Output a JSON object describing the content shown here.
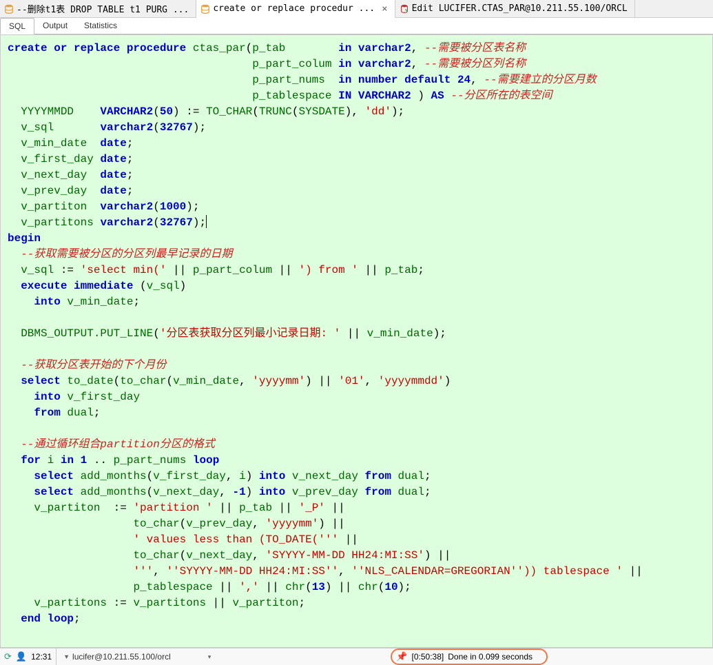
{
  "tabs": [
    {
      "label": "--删除t1表 DROP TABLE t1 PURG ...",
      "active": false,
      "icon": "db"
    },
    {
      "label": "create or replace procedur ...",
      "active": true,
      "icon": "db"
    },
    {
      "label": "Edit LUCIFER.CTAS_PAR@10.211.55.100/ORCL",
      "active": false,
      "icon": "edit"
    }
  ],
  "subtabs": [
    {
      "label": "SQL",
      "active": true
    },
    {
      "label": "Output",
      "active": false
    },
    {
      "label": "Statistics",
      "active": false
    }
  ],
  "code": {
    "l1a": "create or replace procedure",
    "l1b": "ctas_par",
    "l1c": "p_tab",
    "l1d": "in",
    "l1e": "varchar2",
    "l1f": "--需要被分区表名称",
    "l2a": "p_part_colum",
    "l2b": "in",
    "l2c": "varchar2",
    "l2d": "--需要被分区列名称",
    "l3a": "p_part_nums",
    "l3b": "in",
    "l3c": "number",
    "l3d": "default",
    "l3e": "24",
    "l3f": "--需要建立的分区月数",
    "l4a": "p_tablespace",
    "l4b": "IN",
    "l4c": "VARCHAR2",
    "l4d": "AS",
    "l4e": "--分区所在的表空间",
    "l5a": "YYYYMMDD",
    "l5b": "VARCHAR2",
    "l5c": "50",
    "l5d": "TO_CHAR",
    "l5e": "TRUNC",
    "l5f": "SYSDATE",
    "l5g": "'dd'",
    "l6a": "v_sql",
    "l6b": "varchar2",
    "l6c": "32767",
    "l7a": "v_min_date",
    "l7b": "date",
    "l8a": "v_first_day",
    "l8b": "date",
    "l9a": "v_next_day",
    "l9b": "date",
    "l10a": "v_prev_day",
    "l10b": "date",
    "l11a": "v_partiton",
    "l11b": "varchar2",
    "l11c": "1000",
    "l12a": "v_partitons",
    "l12b": "varchar2",
    "l12c": "32767",
    "l13": "begin",
    "l14": "--获取需要被分区的分区列最早记录的日期",
    "l15a": "v_sql",
    "l15b": "'select min('",
    "l15c": "p_part_colum",
    "l15d": "') from '",
    "l15e": "p_tab",
    "l16a": "execute",
    "l16b": "immediate",
    "l16c": "v_sql",
    "l17a": "into",
    "l17b": "v_min_date",
    "l18a": "DBMS_OUTPUT.PUT_LINE",
    "l18b": "'分区表获取分区列最小记录日期: '",
    "l18c": "v_min_date",
    "l19": "--获取分区表开始的下个月份",
    "l20a": "select",
    "l20b": "to_date",
    "l20c": "to_char",
    "l20d": "v_min_date",
    "l20e": "'yyyymm'",
    "l20f": "'01'",
    "l20g": "'yyyymmdd'",
    "l21a": "into",
    "l21b": "v_first_day",
    "l22a": "from",
    "l22b": "dual",
    "l23": "--通过循环组合partition分区的格式",
    "l24a": "for",
    "l24b": "i",
    "l24c": "in",
    "l24d": "1",
    "l24e": "p_part_nums",
    "l24f": "loop",
    "l25a": "select",
    "l25b": "add_months",
    "l25c": "v_first_day",
    "l25d": "i",
    "l25e": "into",
    "l25f": "v_next_day",
    "l25g": "from",
    "l25h": "dual",
    "l26a": "select",
    "l26b": "add_months",
    "l26c": "v_next_day",
    "l26d": "-1",
    "l26e": "into",
    "l26f": "v_prev_day",
    "l26g": "from",
    "l26h": "dual",
    "l27a": "v_partiton",
    "l27b": "'partition '",
    "l27c": "p_tab",
    "l27d": "'_P'",
    "l28a": "to_char",
    "l28b": "v_prev_day",
    "l28c": "'yyyymm'",
    "l29a": "' values less than (TO_DATE('''",
    "l30a": "to_char",
    "l30b": "v_next_day",
    "l30c": "'SYYYY-MM-DD HH24:MI:SS'",
    "l31a": "'''",
    "l31b": "''SYYYY-MM-DD HH24:MI:SS''",
    "l31c": "''NLS_CALENDAR=GREGORIAN'')) tablespace '",
    "l32a": "p_tablespace",
    "l32b": "','",
    "l32c": "chr",
    "l32d": "13",
    "l32e": "chr",
    "l32f": "10",
    "l33a": "v_partitons",
    "l33b": "v_partitons",
    "l33c": "v_partiton",
    "l34a": "end",
    "l34b": "loop"
  },
  "status": {
    "time": "12:31",
    "connection": "lucifer@10.211.55.100/orcl",
    "result_time": "[0:50:38]",
    "result_msg": "Done in 0.099 seconds"
  }
}
